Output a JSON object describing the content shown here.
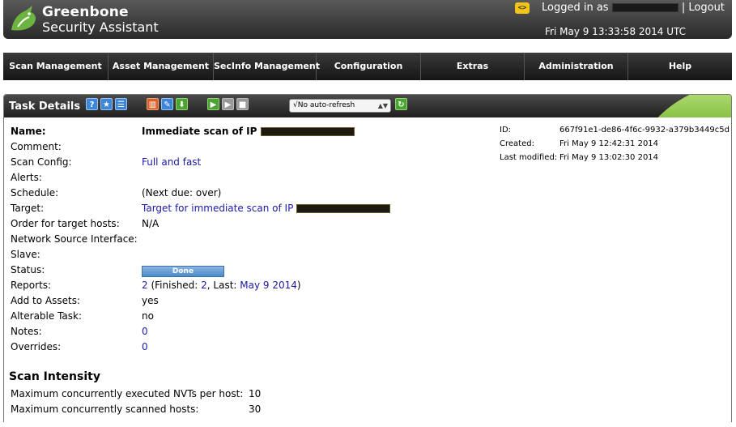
{
  "header": {
    "brand_line1": "Greenbone",
    "brand_line2": "Security Assistant",
    "xml_icon_text": "<>",
    "logged_in_prefix": "Logged in as",
    "separator": "|",
    "logout_label": "Logout",
    "datetime": "Fri May 9 13:33:58 2014 UTC",
    "accent_color": "#f2c41a"
  },
  "nav": {
    "items": [
      {
        "label": "Scan Management"
      },
      {
        "label": "Asset Management"
      },
      {
        "label": "SecInfo Management"
      },
      {
        "label": "Configuration"
      },
      {
        "label": "Extras"
      },
      {
        "label": "Administration"
      },
      {
        "label": "Help"
      }
    ]
  },
  "panel": {
    "title": "Task Details",
    "toolbar_icons": [
      "help-icon",
      "new-task-icon",
      "task-list-icon",
      "delete-icon",
      "edit-icon",
      "export-icon",
      "start-icon",
      "resume-icon",
      "stop-icon",
      "refresh-icon"
    ],
    "refresh_select": {
      "selected": "√No auto-refresh"
    }
  },
  "details": {
    "name_label": "Name:",
    "name_value": "Immediate scan of IP",
    "comment_label": "Comment:",
    "scan_config_label": "Scan Config:",
    "scan_config_value": "Full and fast",
    "alerts_label": "Alerts:",
    "schedule_label": "Schedule:",
    "schedule_value": "(Next due: over)",
    "target_label": "Target:",
    "target_value": "Target for immediate scan of IP",
    "order_label": "Order for target hosts:",
    "order_value": "N/A",
    "nsi_label": "Network Source Interface:",
    "slave_label": "Slave:",
    "status_label": "Status:",
    "status_value": "Done",
    "status_progress": 1.0,
    "reports_label": "Reports:",
    "reports_count": "2",
    "reports_finished_prefix": " (Finished: ",
    "reports_finished": "2",
    "reports_last_prefix": ", Last: ",
    "reports_last": "May 9 2014",
    "reports_suffix": ")",
    "add_assets_label": "Add to Assets:",
    "add_assets_value": "yes",
    "alterable_label": "Alterable Task:",
    "alterable_value": "no",
    "notes_label": "Notes:",
    "notes_value": "0",
    "overrides_label": "Overrides:",
    "overrides_value": "0"
  },
  "meta": {
    "id_label": "ID:",
    "id_value": "667f91e1-de86-4f6c-9932-a379b3449c5d",
    "created_label": "Created:",
    "created_value": "Fri May 9 12:42:31 2014",
    "modified_label": "Last modified:",
    "modified_value": "Fri May 9 13:02:30 2014"
  },
  "intensity": {
    "title": "Scan Intensity",
    "nvts_label": "Maximum concurrently executed NVTs per host:",
    "nvts_value": "10",
    "hosts_label": "Maximum concurrently scanned hosts:",
    "hosts_value": "30"
  }
}
